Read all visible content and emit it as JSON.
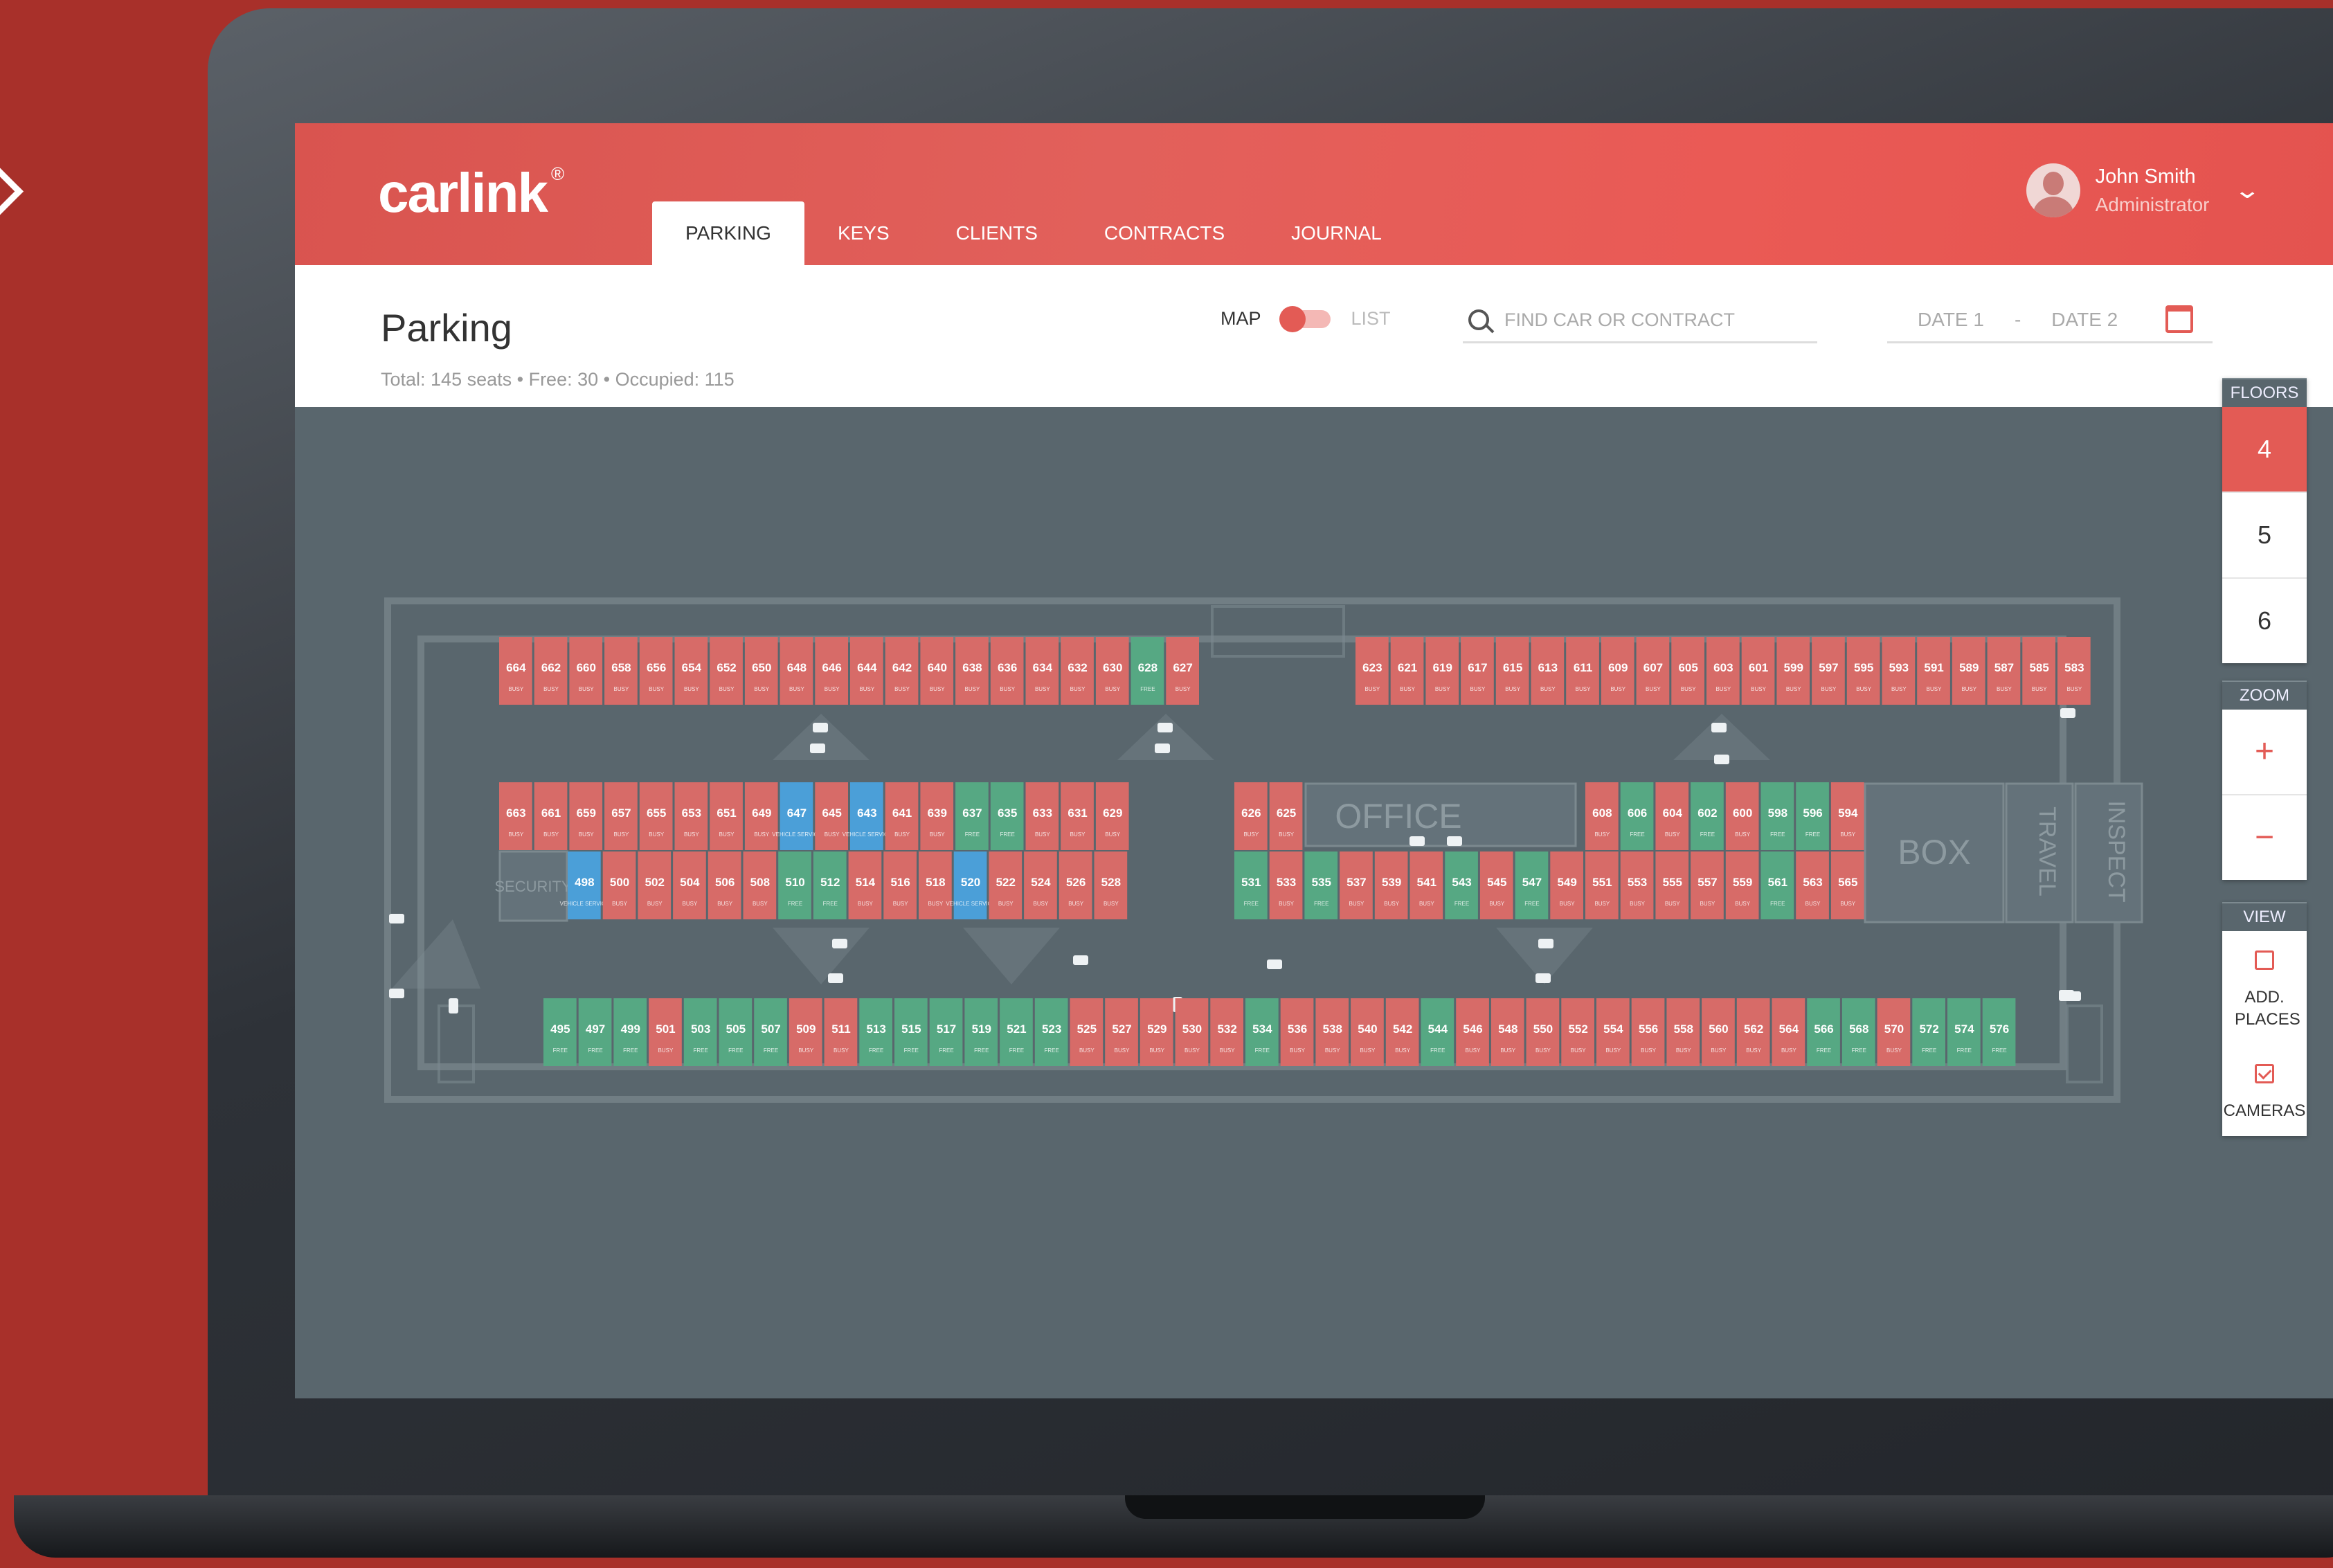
{
  "app": {
    "logo": "carlink",
    "logo_mark": "®"
  },
  "nav": {
    "tabs": [
      {
        "label": "PARKING",
        "active": true
      },
      {
        "label": "KEYS"
      },
      {
        "label": "CLIENTS"
      },
      {
        "label": "CONTRACTS"
      },
      {
        "label": "JOURNAL"
      }
    ]
  },
  "user": {
    "name": "John Smith",
    "role": "Administrator"
  },
  "page": {
    "title": "Parking",
    "summary": "Total: 145 seats • Free: 30 • Occupied: 115"
  },
  "view_toggle": {
    "map": "MAP",
    "list": "LIST",
    "selected": "MAP"
  },
  "search": {
    "placeholder": "FIND CAR OR CONTRACT"
  },
  "dates": {
    "date1": "DATE 1",
    "sep": "-",
    "date2": "DATE 2"
  },
  "floors": {
    "title": "FLOORS",
    "items": [
      "4",
      "5",
      "6"
    ],
    "selected": "4"
  },
  "zoom": {
    "title": "ZOOM",
    "in": "+",
    "out": "−"
  },
  "view": {
    "title": "VIEW",
    "items": [
      {
        "label": "ADD. PLACES",
        "checked": false
      },
      {
        "label": "CAMERAS",
        "checked": true
      }
    ]
  },
  "colors": {
    "busy": "#d76b68",
    "free": "#56a883",
    "vehicle_service": "#4b9fd8",
    "accent": "#e35b55"
  },
  "status_labels": {
    "B": "BUSY",
    "F": "FREE",
    "V": "VEHICLE SERVICE"
  },
  "map": {
    "zones": [
      "OFFICE",
      "BOX",
      "TRAVEL",
      "INSPECT",
      "SECURITY"
    ],
    "rows": [
      {
        "spots": [
          [
            "664",
            "B"
          ],
          [
            "662",
            "B"
          ],
          [
            "660",
            "B"
          ],
          [
            "658",
            "B"
          ],
          [
            "656",
            "B"
          ],
          [
            "654",
            "B"
          ],
          [
            "652",
            "B"
          ],
          [
            "650",
            "B"
          ],
          [
            "648",
            "B"
          ],
          [
            "646",
            "B"
          ],
          [
            "644",
            "B"
          ],
          [
            "642",
            "B"
          ],
          [
            "640",
            "B"
          ],
          [
            "638",
            "B"
          ],
          [
            "636",
            "B"
          ],
          [
            "634",
            "B"
          ],
          [
            "632",
            "B"
          ],
          [
            "630",
            "B"
          ],
          [
            "628",
            "F"
          ],
          [
            "627",
            "B"
          ]
        ]
      },
      {
        "spots": [
          [
            "623",
            "B"
          ],
          [
            "621",
            "B"
          ],
          [
            "619",
            "B"
          ],
          [
            "617",
            "B"
          ],
          [
            "615",
            "B"
          ],
          [
            "613",
            "B"
          ],
          [
            "611",
            "B"
          ],
          [
            "609",
            "B"
          ],
          [
            "607",
            "B"
          ],
          [
            "605",
            "B"
          ],
          [
            "603",
            "B"
          ],
          [
            "601",
            "B"
          ],
          [
            "599",
            "B"
          ],
          [
            "597",
            "B"
          ],
          [
            "595",
            "B"
          ],
          [
            "593",
            "B"
          ],
          [
            "591",
            "B"
          ],
          [
            "589",
            "B"
          ],
          [
            "587",
            "B"
          ],
          [
            "585",
            "B"
          ],
          [
            "583",
            "B"
          ]
        ]
      },
      {
        "spots": [
          [
            "663",
            "B"
          ],
          [
            "661",
            "B"
          ],
          [
            "659",
            "B"
          ],
          [
            "657",
            "B"
          ],
          [
            "655",
            "B"
          ],
          [
            "653",
            "B"
          ],
          [
            "651",
            "B"
          ],
          [
            "649",
            "B"
          ],
          [
            "647",
            "V"
          ],
          [
            "645",
            "B"
          ],
          [
            "643",
            "V"
          ],
          [
            "641",
            "B"
          ],
          [
            "639",
            "B"
          ],
          [
            "637",
            "F"
          ],
          [
            "635",
            "F"
          ],
          [
            "633",
            "B"
          ],
          [
            "631",
            "B"
          ],
          [
            "629",
            "B"
          ]
        ]
      },
      {
        "spots": [
          [
            "498",
            "V"
          ],
          [
            "500",
            "B"
          ],
          [
            "502",
            "B"
          ],
          [
            "504",
            "B"
          ],
          [
            "506",
            "B"
          ],
          [
            "508",
            "B"
          ],
          [
            "510",
            "F"
          ],
          [
            "512",
            "F"
          ],
          [
            "514",
            "B"
          ],
          [
            "516",
            "B"
          ],
          [
            "518",
            "B"
          ],
          [
            "520",
            "V"
          ],
          [
            "522",
            "B"
          ],
          [
            "524",
            "B"
          ],
          [
            "526",
            "B"
          ],
          [
            "528",
            "B"
          ]
        ]
      },
      {
        "spots": [
          [
            "626",
            "B"
          ],
          [
            "625",
            "B"
          ]
        ]
      },
      {
        "spots": [
          [
            "531",
            "F"
          ],
          [
            "533",
            "B"
          ],
          [
            "535",
            "F"
          ],
          [
            "537",
            "B"
          ],
          [
            "539",
            "B"
          ],
          [
            "541",
            "B"
          ],
          [
            "543",
            "F"
          ],
          [
            "545",
            "B"
          ],
          [
            "547",
            "F"
          ],
          [
            "549",
            "B"
          ],
          [
            "551",
            "B"
          ],
          [
            "553",
            "B"
          ],
          [
            "555",
            "B"
          ],
          [
            "557",
            "B"
          ],
          [
            "559",
            "B"
          ],
          [
            "561",
            "F"
          ],
          [
            "563",
            "B"
          ],
          [
            "565",
            "B"
          ]
        ]
      },
      {
        "spots": [
          [
            "608",
            "B"
          ],
          [
            "606",
            "F"
          ],
          [
            "604",
            "B"
          ],
          [
            "602",
            "F"
          ],
          [
            "600",
            "B"
          ],
          [
            "598",
            "F"
          ],
          [
            "596",
            "F"
          ],
          [
            "594",
            "B"
          ]
        ]
      },
      {
        "spots": [
          [
            "495",
            "F"
          ],
          [
            "497",
            "F"
          ],
          [
            "499",
            "F"
          ],
          [
            "501",
            "B"
          ],
          [
            "503",
            "F"
          ],
          [
            "505",
            "F"
          ],
          [
            "507",
            "F"
          ],
          [
            "509",
            "B"
          ],
          [
            "511",
            "B"
          ],
          [
            "513",
            "F"
          ],
          [
            "515",
            "F"
          ],
          [
            "517",
            "F"
          ],
          [
            "519",
            "F"
          ],
          [
            "521",
            "F"
          ],
          [
            "523",
            "F"
          ],
          [
            "525",
            "B"
          ],
          [
            "527",
            "B"
          ],
          [
            "529",
            "B"
          ],
          [
            "530",
            "B"
          ],
          [
            "532",
            "B"
          ],
          [
            "534",
            "F"
          ],
          [
            "536",
            "B"
          ],
          [
            "538",
            "B"
          ],
          [
            "540",
            "B"
          ],
          [
            "542",
            "B"
          ],
          [
            "544",
            "F"
          ],
          [
            "546",
            "B"
          ],
          [
            "548",
            "B"
          ],
          [
            "550",
            "B"
          ],
          [
            "552",
            "B"
          ],
          [
            "554",
            "B"
          ],
          [
            "556",
            "B"
          ],
          [
            "558",
            "B"
          ],
          [
            "560",
            "B"
          ],
          [
            "562",
            "B"
          ],
          [
            "564",
            "B"
          ],
          [
            "566",
            "F"
          ],
          [
            "568",
            "F"
          ],
          [
            "570",
            "B"
          ],
          [
            "572",
            "F"
          ],
          [
            "574",
            "F"
          ],
          [
            "576",
            "F"
          ]
        ]
      }
    ]
  }
}
